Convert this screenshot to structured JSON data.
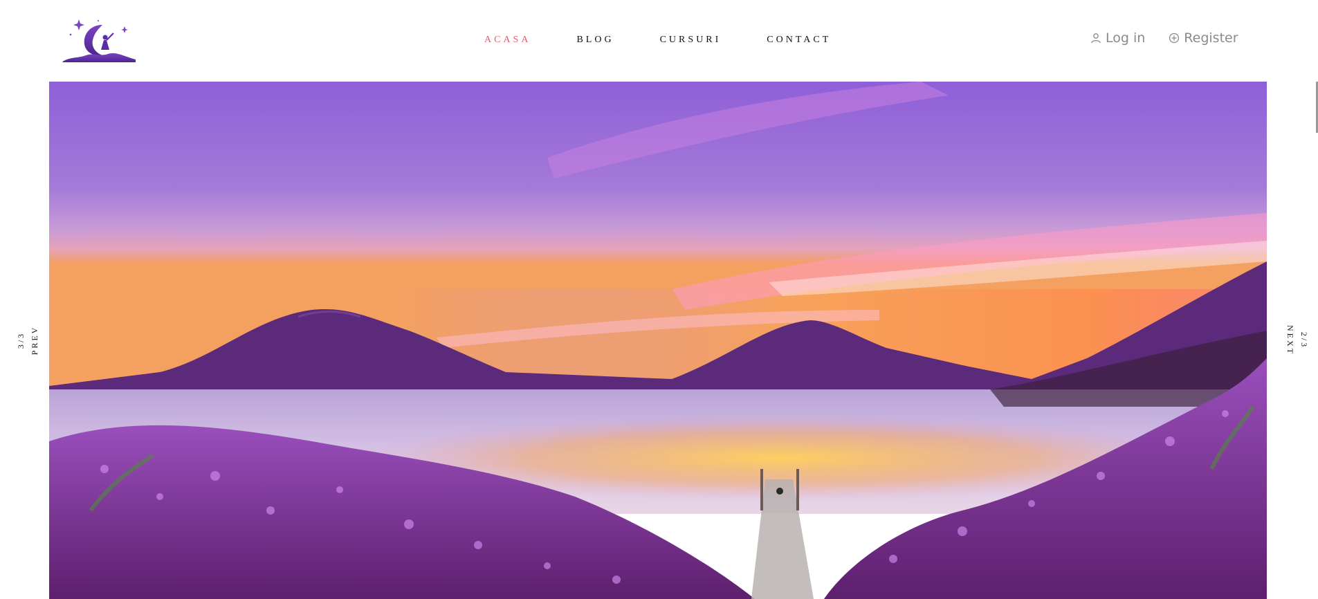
{
  "nav": {
    "items": [
      {
        "label": "ACASA",
        "active": true
      },
      {
        "label": "BLOG",
        "active": false
      },
      {
        "label": "CURSURI",
        "active": false
      },
      {
        "label": "CONTACT",
        "active": false
      }
    ]
  },
  "auth": {
    "login_label": "Log in",
    "register_label": "Register"
  },
  "slider": {
    "prev_label": "PREV",
    "prev_count": "3/3",
    "next_label": "NEXT",
    "next_count": "2/3"
  },
  "colors": {
    "accent": "#e65a6b",
    "brand_purple": "#6a3aa8"
  },
  "icons": {
    "logo": "moon-fairy-logo",
    "login": "user-icon",
    "register": "plus-circle-icon"
  }
}
